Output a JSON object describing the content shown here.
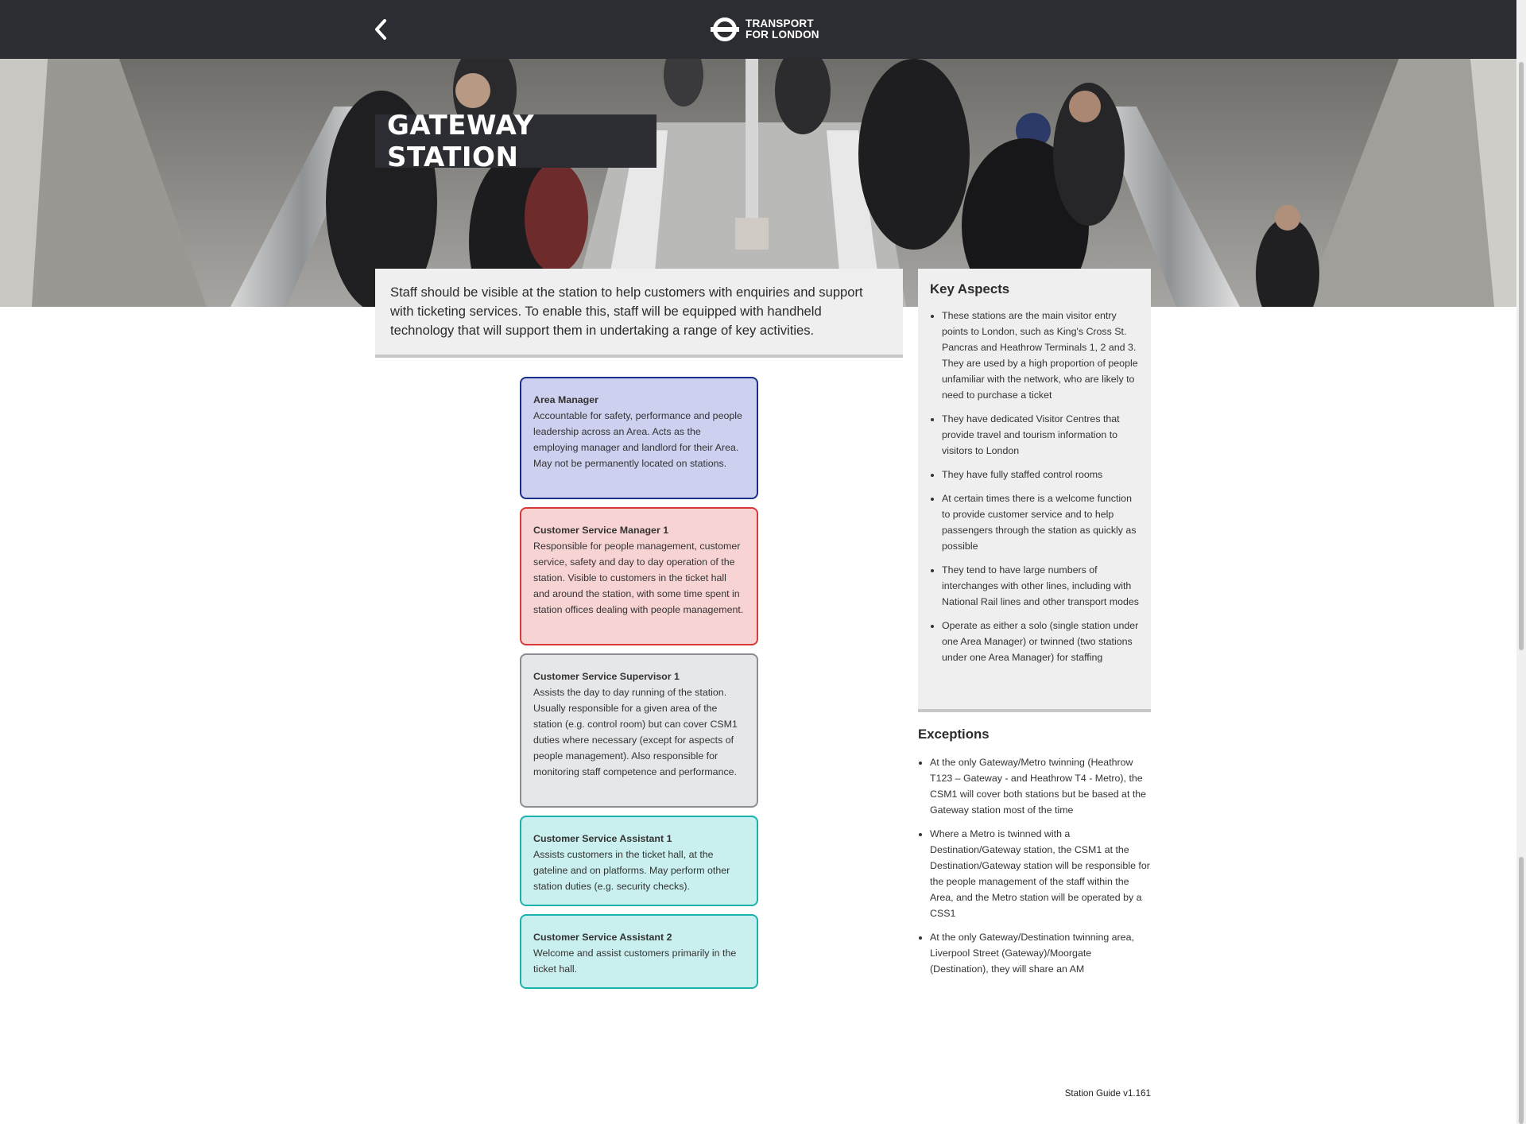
{
  "header": {
    "back_icon": "chevron-left-icon",
    "logo_icon": "roundel-icon",
    "logo_line1": "TRANSPORT",
    "logo_line2": "FOR LONDON",
    "background_color": "#2b2d33"
  },
  "hero": {
    "title": "GATEWAY STATION"
  },
  "intro": {
    "text": "Staff should be visible at the station to help customers with enquiries and support with ticketing services. To enable this, staff will be equipped with handheld technology that will support them in undertaking a range of key activities."
  },
  "roles": [
    {
      "title": "Area Manager",
      "description": "Accountable for safety, performance and people leadership across an Area. Acts as the employing manager and landlord for their Area. May not be permanently located on stations.",
      "color": "#cdd0ee",
      "border": "#1a2e8c"
    },
    {
      "title": "Customer Service Manager 1",
      "description": "Responsible for people management, customer service, safety and day to day operation of the station. Visible to customers in the ticket hall and around the station, with some time spent in station offices dealing with people management.",
      "color": "#f8d3d3",
      "border": "#d83a3a"
    },
    {
      "title": "Customer Service Supervisor 1",
      "description": "Assists the day to day running of the station. Usually responsible for a given area of the station (e.g. control room) but can cover CSM1 duties where necessary (except for aspects of people management). Also responsible for monitoring staff competence and performance.",
      "color": "#e6e7e9",
      "border": "#8b8d92"
    },
    {
      "title": "Customer Service Assistant 1",
      "description": "Assists customers in the ticket hall, at the gateline and on platforms. May perform other station duties (e.g. security checks).",
      "color": "#c9efee",
      "border": "#1bb1ae"
    },
    {
      "title": "Customer Service Assistant 2",
      "description": "Welcome and assist customers primarily in the ticket hall.",
      "color": "#c9efee",
      "border": "#1bb1ae"
    }
  ],
  "key_aspects": {
    "heading": "Key Aspects",
    "items": [
      "These stations are the main visitor entry points to London, such as King's Cross St. Pancras and Heathrow Terminals 1, 2 and 3. They are used by a high proportion of people unfamiliar with the network, who are likely to need to purchase a ticket",
      "They have dedicated Visitor Centres that provide travel and tourism information to visitors to London",
      "They have fully staffed control rooms",
      "At certain times there is a welcome function to provide customer service and to help passengers through the station as quickly as possible",
      "They tend to have large numbers of interchanges with other lines, including with National Rail lines and other transport modes",
      "Operate as either a solo (single station under one Area Manager) or twinned (two stations under one Area Manager) for staffing"
    ]
  },
  "exceptions": {
    "heading": "Exceptions",
    "items": [
      "At the only Gateway/Metro twinning (Heathrow T123 – Gateway - and Heathrow T4 - Metro), the CSM1 will cover both stations but be based at the Gateway station most of the time",
      "Where a Metro is twinned with a Destination/Gateway station, the CSM1 at the Destination/Gateway station will be responsible for the people management of the staff within the Area, and the Metro station will be operated by a CSS1",
      "At the only Gateway/Destination twinning area, Liverpool Street (Gateway)/Moorgate (Destination), they will share an AM"
    ]
  },
  "footer": {
    "version": "Station Guide v1.161"
  }
}
